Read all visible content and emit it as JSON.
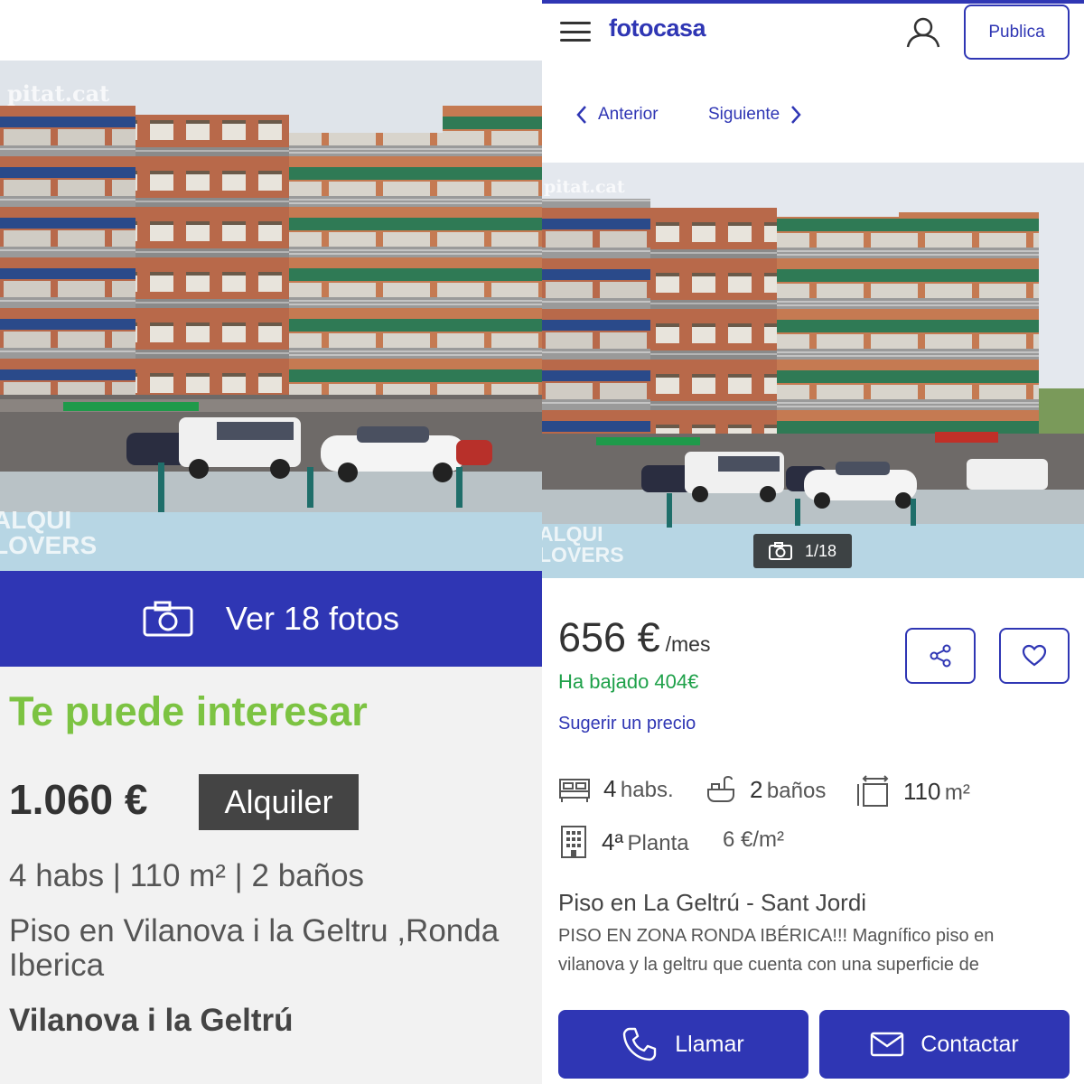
{
  "left": {
    "photo_watermark_top": "pitat.cat",
    "photo_watermark_bottom_1": "ALQUI",
    "photo_watermark_bottom_2": "LOVERS",
    "photos_button_label": "Ver 18 fotos",
    "section_heading": "Te puede interesar",
    "price": "1.060 €",
    "operation_badge": "Alquiler",
    "features": "4 habs | 110 m² | 2 baños",
    "address": "Piso en Vilanova i la Geltru ,Ronda Iberica",
    "city": "Vilanova i la Geltrú"
  },
  "right": {
    "brand": "fotocasa",
    "publish_button": "Publica",
    "nav_previous": "Anterior",
    "nav_next": "Siguiente",
    "photo_watermark_top": "pitat.cat",
    "photo_watermark_bottom_1": "ALQUI",
    "photo_watermark_bottom_2": "LOVERS",
    "photo_counter": "1/18",
    "price": "656 €",
    "price_period": "/mes",
    "price_drop": "Ha bajado 404€",
    "suggest_price": "Sugerir un precio",
    "rooms_value": "4",
    "rooms_unit": "habs.",
    "baths_value": "2",
    "baths_unit": "baños",
    "area_value": "110",
    "area_unit": "m²",
    "floor_value": "4ª",
    "floor_unit": "Planta",
    "price_per_m2": "6 €/m²",
    "property_type": "Piso en La Geltrú - Sant Jordi",
    "description": "PISO EN ZONA RONDA IBÉRICA!!! Magnífico piso en vilanova y la geltru que cuenta con una superficie de",
    "call_button": "Llamar",
    "contact_button": "Contactar"
  },
  "colors": {
    "brand_blue": "#2f36b4",
    "interest_green": "#7cc342",
    "price_drop_green": "#1fa14a",
    "badge_gray": "#444444"
  }
}
